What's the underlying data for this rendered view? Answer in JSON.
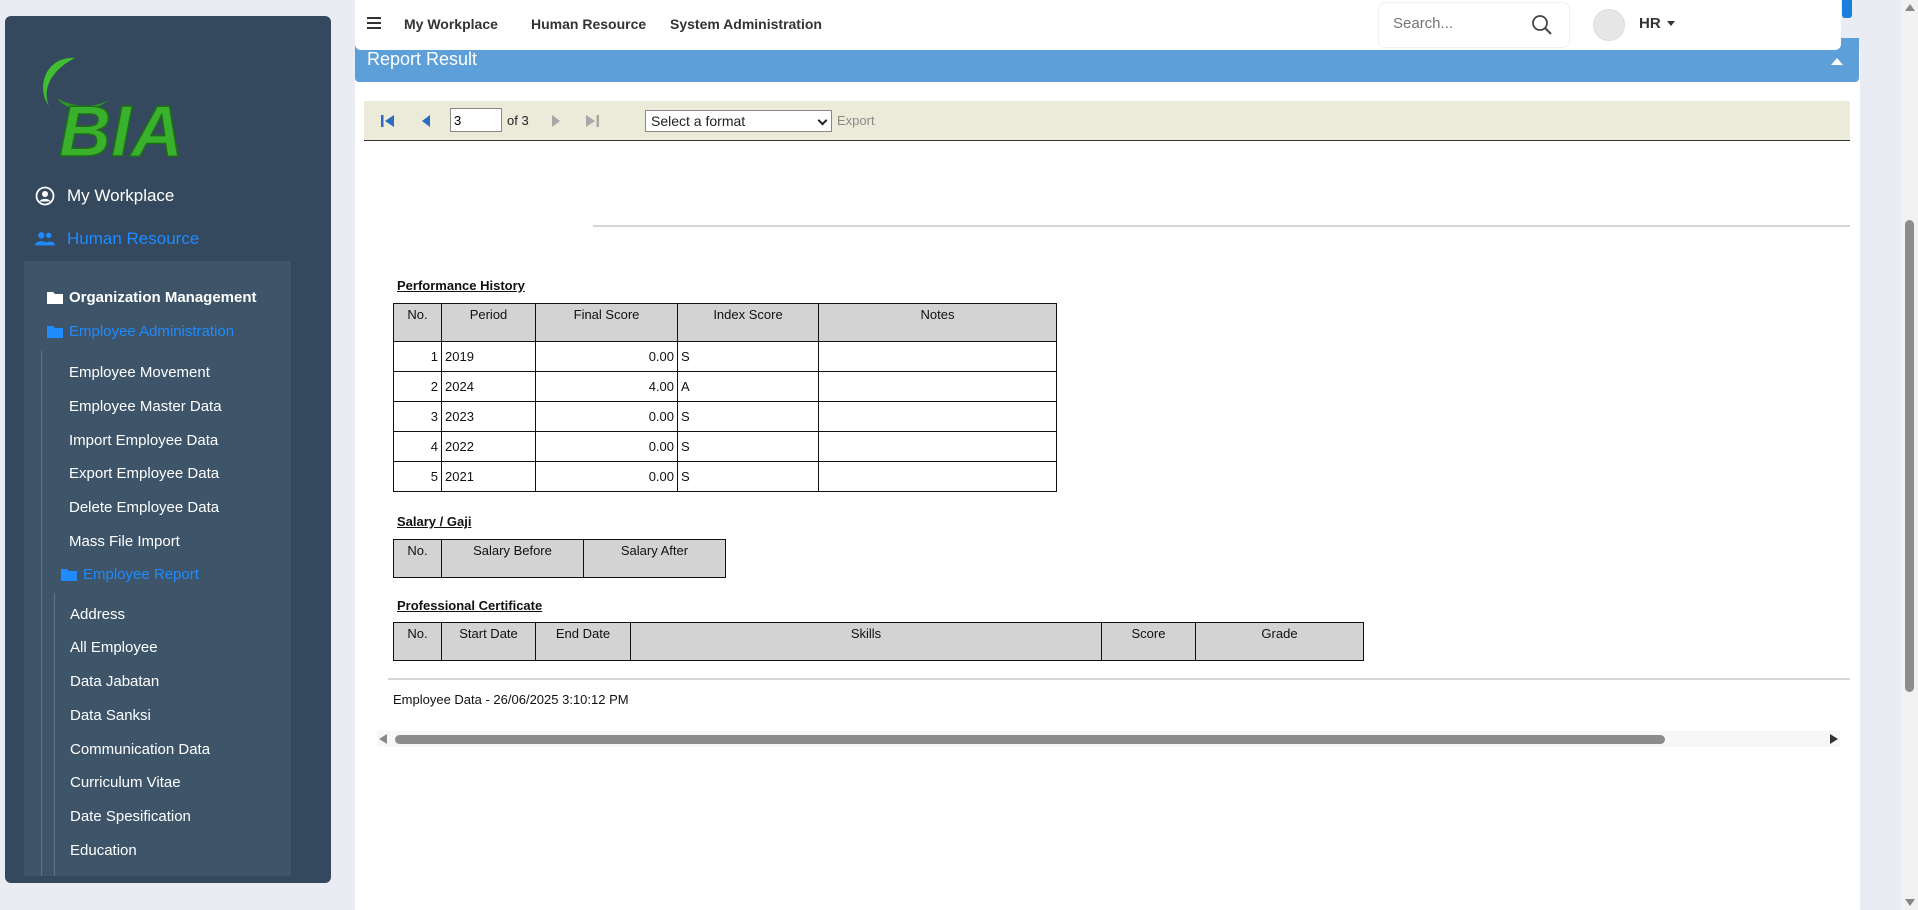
{
  "sidebar": {
    "logo_text": "BIA",
    "my_workplace": "My Workplace",
    "human_resource": "Human Resource",
    "organization_management": "Organization Management",
    "employee_administration": "Employee Administration",
    "items": [
      "Employee Movement",
      "Employee Master Data",
      "Import Employee Data",
      "Export Employee Data",
      "Delete Employee Data",
      "Mass File Import"
    ],
    "employee_report": "Employee Report",
    "report_items": [
      "Address",
      "All Employee",
      "Data Jabatan",
      "Data Sanksi",
      "Communication Data",
      "Curriculum Vitae",
      "Date Spesification",
      "Education"
    ]
  },
  "topbar": {
    "nav": [
      "My Workplace",
      "Human Resource",
      "System Administration"
    ],
    "search_placeholder": "Search...",
    "user": "HR"
  },
  "report": {
    "title": "Report Result",
    "page_value": "3",
    "of_pages": "of 3",
    "format_placeholder": "Select a format",
    "export_label": "Export",
    "performance": {
      "title": "Performance History",
      "headers": [
        "No.",
        "Period",
        "Final Score",
        "Index Score",
        "Notes"
      ],
      "rows": [
        [
          "1",
          "2019",
          "0.00",
          "S",
          ""
        ],
        [
          "2",
          "2024",
          "4.00",
          "A",
          ""
        ],
        [
          "3",
          "2023",
          "0.00",
          "S",
          ""
        ],
        [
          "4",
          "2022",
          "0.00",
          "S",
          ""
        ],
        [
          "5",
          "2021",
          "0.00",
          "S",
          ""
        ]
      ]
    },
    "salary": {
      "title": "Salary / Gaji",
      "headers": [
        "No.",
        "Salary Before",
        "Salary After"
      ]
    },
    "certificate": {
      "title": "Professional Certificate",
      "headers": [
        "No.",
        "Start Date",
        "End Date",
        "Skills",
        "Score",
        "Grade"
      ]
    },
    "footer": "Employee Data - 26/06/2025 3:10:12 PM"
  }
}
